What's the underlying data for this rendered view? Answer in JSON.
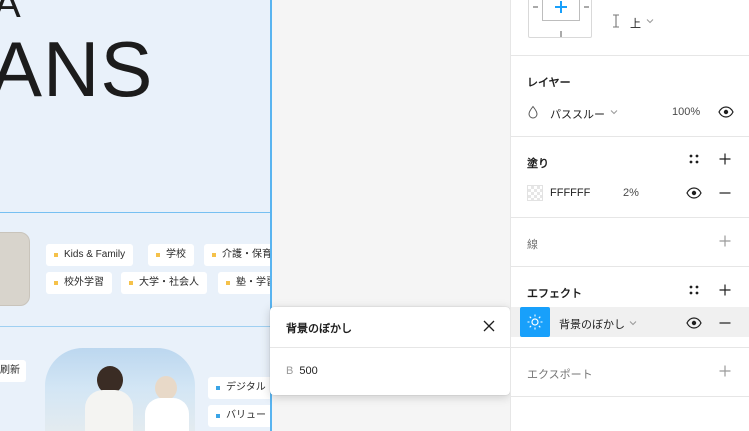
{
  "canvas": {
    "hero_text": "ANS",
    "hero_partial": "A",
    "tags_row1": [
      "Kids & Family",
      "学校",
      "介護・保育"
    ],
    "tags_row2": [
      "校外学習",
      "大学・社会人",
      "塾・学習"
    ],
    "tags_row3": [
      "デジタル",
      "バリュー"
    ],
    "side_tag": "刷新"
  },
  "popover": {
    "title": "背景のぼかし",
    "field_label": "B",
    "field_value": "500"
  },
  "panel": {
    "constraint_vertical": "上",
    "layer": {
      "title": "レイヤー",
      "blend_mode": "パススルー",
      "opacity": "100%"
    },
    "fill": {
      "title": "塗り",
      "hex": "FFFFFF",
      "opacity": "2%"
    },
    "stroke": {
      "title": "線"
    },
    "effects": {
      "title": "エフェクト",
      "effect_name": "背景のぼかし"
    },
    "export": {
      "title": "エクスポート"
    }
  },
  "colors": {
    "accent": "#18a0fb",
    "frame_outline": "#59b4f0",
    "tag_dot_yellow": "#f5c14a",
    "tag_dot_blue": "#3aa4e6"
  }
}
